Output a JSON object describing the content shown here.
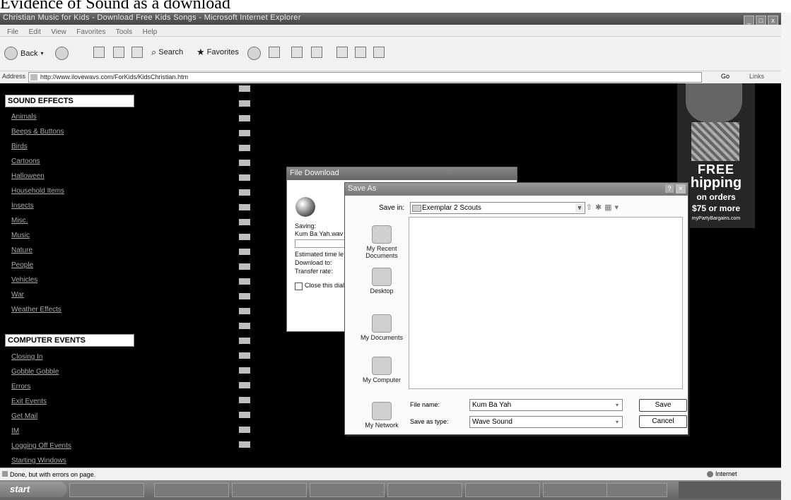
{
  "caption": "Evidence of Sound as a download",
  "window": {
    "title": "Christian Music for Kids - Download Free Kids Songs - Microsoft Internet Explorer",
    "controls": [
      "_",
      "□",
      "x"
    ]
  },
  "menubar": [
    "File",
    "Edit",
    "View",
    "Favorites",
    "Tools",
    "Help"
  ],
  "toolbar": {
    "back": "Back",
    "search": "Search",
    "favorites": "Favorites"
  },
  "addressbar": {
    "label": "Address",
    "url": "http://www.ilovewavs.com/ForKids/KidsChristian.htm",
    "go": "Go",
    "links": "Links"
  },
  "page": {
    "section1": {
      "heading": "SOUND EFFECTS",
      "links": [
        "Animals",
        "Beeps & Buttons",
        "Birds",
        "Cartoons",
        "Halloween",
        "Household Items",
        "Insects",
        "Misc.",
        "Music",
        "Nature",
        "People",
        "Vehicles",
        "War",
        "Weather Effects"
      ]
    },
    "section2": {
      "heading": "COMPUTER EVENTS",
      "links": [
        "Closing In",
        "Gobble Gobble",
        "Errors",
        "Exit Events",
        "Get Mail",
        "IM",
        "Logging Off Events",
        "Starting Windows"
      ]
    },
    "ad": {
      "line1": "FREE",
      "line2": "hipping",
      "line3": "on orders",
      "line4": "$75 or more",
      "line5": "myPartyBargains.com"
    }
  },
  "file_download": {
    "title": "File Download",
    "saving_label": "Saving:",
    "filename": "Kum Ba Yah.wav",
    "estimated": "Estimated time le",
    "download_to": "Download to:",
    "transfer_rate": "Transfer rate:",
    "close_checkbox": "Close this dial"
  },
  "save_as": {
    "title": "Save As",
    "save_in_label": "Save in:",
    "save_in_value": "Exemplar 2 Scouts",
    "places": [
      "My Recent Documents",
      "Desktop",
      "My Documents",
      "My Computer",
      "My Network"
    ],
    "file_name_label": "File name:",
    "file_name_value": "Kum Ba Yah",
    "save_type_label": "Save as type:",
    "save_type_value": "Wave Sound",
    "save_button": "Save",
    "cancel_button": "Cancel"
  },
  "statusbar": {
    "text": "Done, but with errors on page.",
    "zone": "Internet"
  },
  "taskbar": {
    "start": "start"
  }
}
